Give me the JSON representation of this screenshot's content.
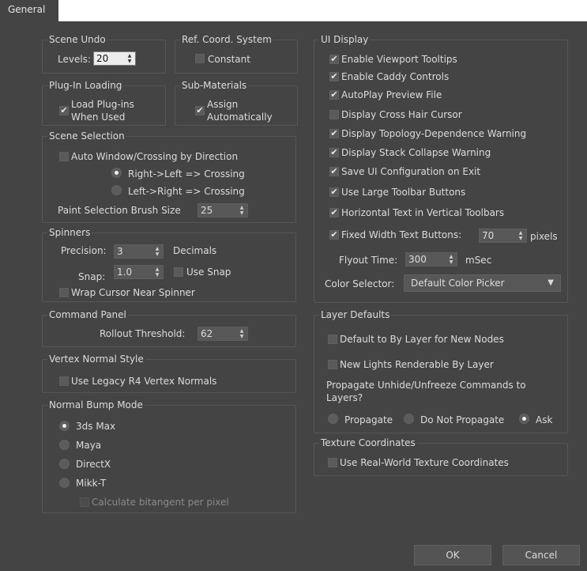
{
  "tab": {
    "general": "General"
  },
  "scene_undo": {
    "title": "Scene Undo",
    "levels_label": "Levels:",
    "levels_value": "20"
  },
  "ref_coord": {
    "title": "Ref. Coord. System",
    "constant_label": "Constant",
    "constant_checked": false
  },
  "plugin_loading": {
    "title": "Plug-In Loading",
    "load_label_1": "Load Plug-ins",
    "load_label_2": "When Used",
    "load_checked": true
  },
  "sub_materials": {
    "title": "Sub-Materials",
    "assign_label_1": "Assign",
    "assign_label_2": "Automatically",
    "assign_checked": true
  },
  "scene_selection": {
    "title": "Scene Selection",
    "auto_window_label": "Auto Window/Crossing by Direction",
    "auto_window_checked": false,
    "right_left_label": "Right->Left => Crossing",
    "left_right_label": "Left->Right => Crossing",
    "selected_direction": "right_left",
    "paint_brush_label": "Paint Selection Brush Size",
    "paint_brush_value": "25"
  },
  "spinners": {
    "title": "Spinners",
    "precision_label": "Precision:",
    "precision_value": "3",
    "decimals_label": "Decimals",
    "snap_label": "Snap:",
    "snap_value": "1.0",
    "use_snap_label": "Use Snap",
    "use_snap_checked": false,
    "wrap_cursor_label": "Wrap Cursor Near Spinner",
    "wrap_cursor_checked": false
  },
  "command_panel": {
    "title": "Command Panel",
    "rollout_label": "Rollout Threshold:",
    "rollout_value": "62"
  },
  "vertex_normal": {
    "title": "Vertex Normal Style",
    "legacy_label": "Use Legacy R4 Vertex Normals",
    "legacy_checked": false
  },
  "normal_bump": {
    "title": "Normal Bump Mode",
    "options": [
      "3ds Max",
      "Maya",
      "DirectX",
      "Mikk-T"
    ],
    "selected": "3ds Max",
    "bitangent_label": "Calculate bitangent per pixel",
    "bitangent_checked": false
  },
  "ui_display": {
    "title": "UI Display",
    "options": [
      {
        "label": "Enable Viewport Tooltips",
        "checked": true
      },
      {
        "label": "Enable Caddy Controls",
        "checked": true
      },
      {
        "label": "AutoPlay Preview File",
        "checked": true
      },
      {
        "label": "Display Cross Hair Cursor",
        "checked": false
      },
      {
        "label": "Display Topology-Dependence Warning",
        "checked": true
      },
      {
        "label": "Display Stack Collapse Warning",
        "checked": true
      },
      {
        "label": "Save UI Configuration on Exit",
        "checked": true
      },
      {
        "label": "Use Large Toolbar Buttons",
        "checked": true
      },
      {
        "label": "Horizontal Text in Vertical Toolbars",
        "checked": true
      },
      {
        "label": "Fixed Width Text Buttons:",
        "checked": true
      }
    ],
    "fixed_width_value": "70",
    "pixels_label": "pixels",
    "flyout_label": "Flyout Time:",
    "flyout_value": "300",
    "msec_label": "mSec",
    "color_selector_label": "Color Selector:",
    "color_selector_value": "Default Color Picker"
  },
  "layer_defaults": {
    "title": "Layer Defaults",
    "default_bylayer_label": "Default to By Layer for New Nodes",
    "default_bylayer_checked": false,
    "new_lights_label": "New Lights Renderable By Layer",
    "new_lights_checked": false,
    "propagate_text_1": "Propagate Unhide/Unfreeze Commands to",
    "propagate_text_2": "Layers?",
    "propagate_options": [
      "Propagate",
      "Do Not Propagate",
      "Ask"
    ],
    "propagate_selected": "Ask"
  },
  "texture_coords": {
    "title": "Texture Coordinates",
    "real_world_label": "Use Real-World Texture Coordinates",
    "real_world_checked": false
  },
  "buttons": {
    "ok": "OK",
    "cancel": "Cancel"
  },
  "glyphs": {
    "check": "✔",
    "spin_up": "▲",
    "spin_down": "▼",
    "dropdown": "▼"
  }
}
